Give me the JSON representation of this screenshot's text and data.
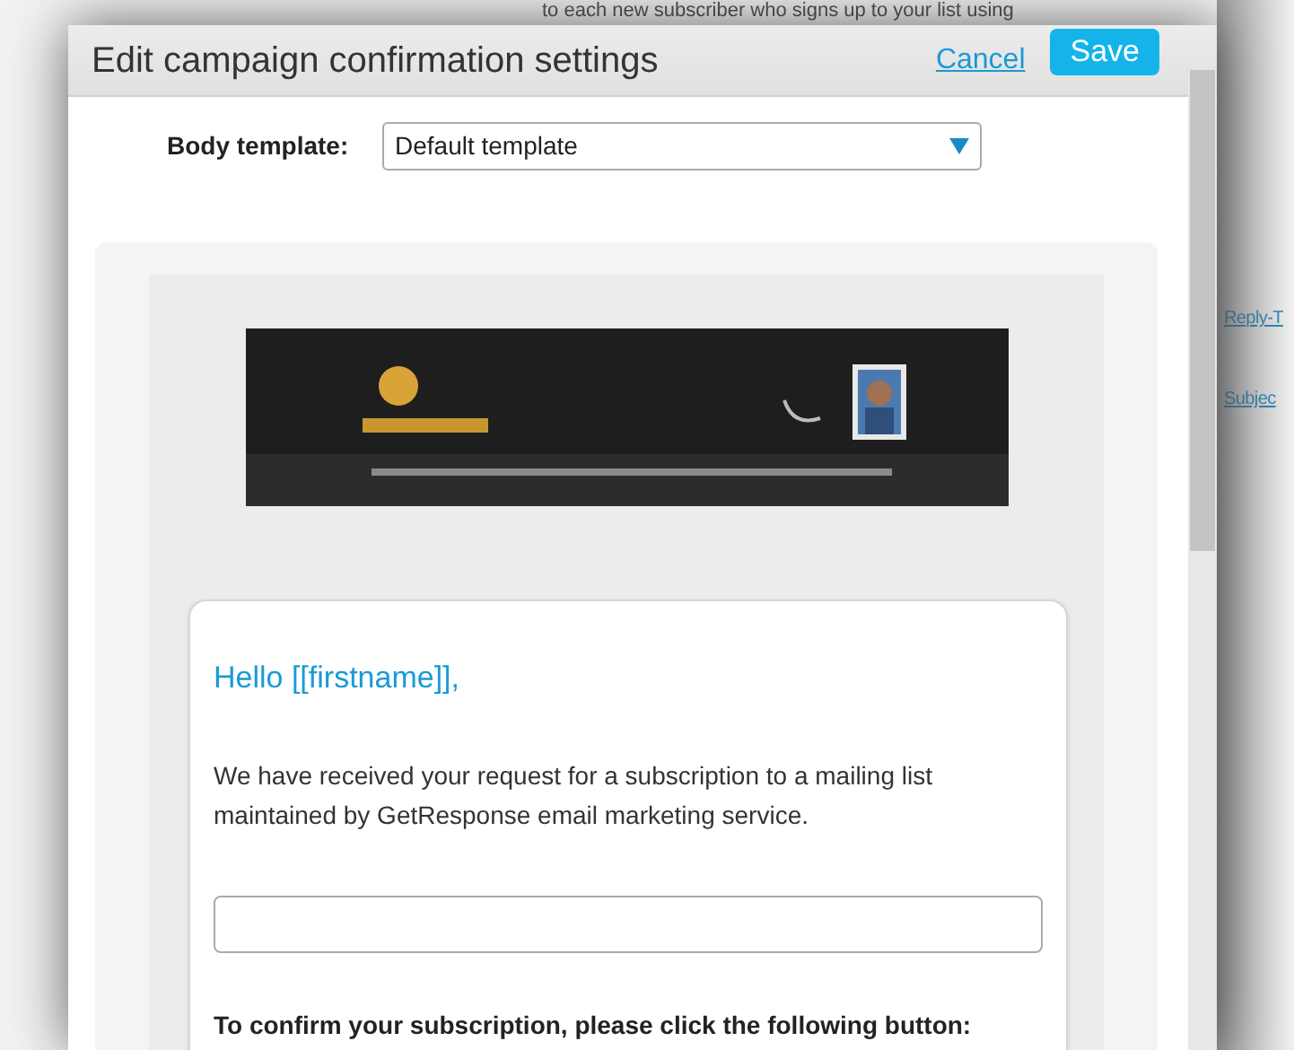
{
  "background_page": {
    "intro_text": "to each new subscriber who signs up to your list using",
    "links": [
      "Reply-T",
      "Subjec"
    ]
  },
  "dialog": {
    "title": "Edit campaign confirmation settings",
    "cancel": "Cancel",
    "save": "Save",
    "body_template": {
      "label": "Body template:",
      "value": "Default template"
    },
    "preview": {
      "greeting": "Hello [[firstname]],",
      "paragraph": "We have received your request for a subscription to a mailing list maintained by GetResponse email marketing service.",
      "confirm_text": "To confirm your subscription, please click the following button:"
    }
  }
}
